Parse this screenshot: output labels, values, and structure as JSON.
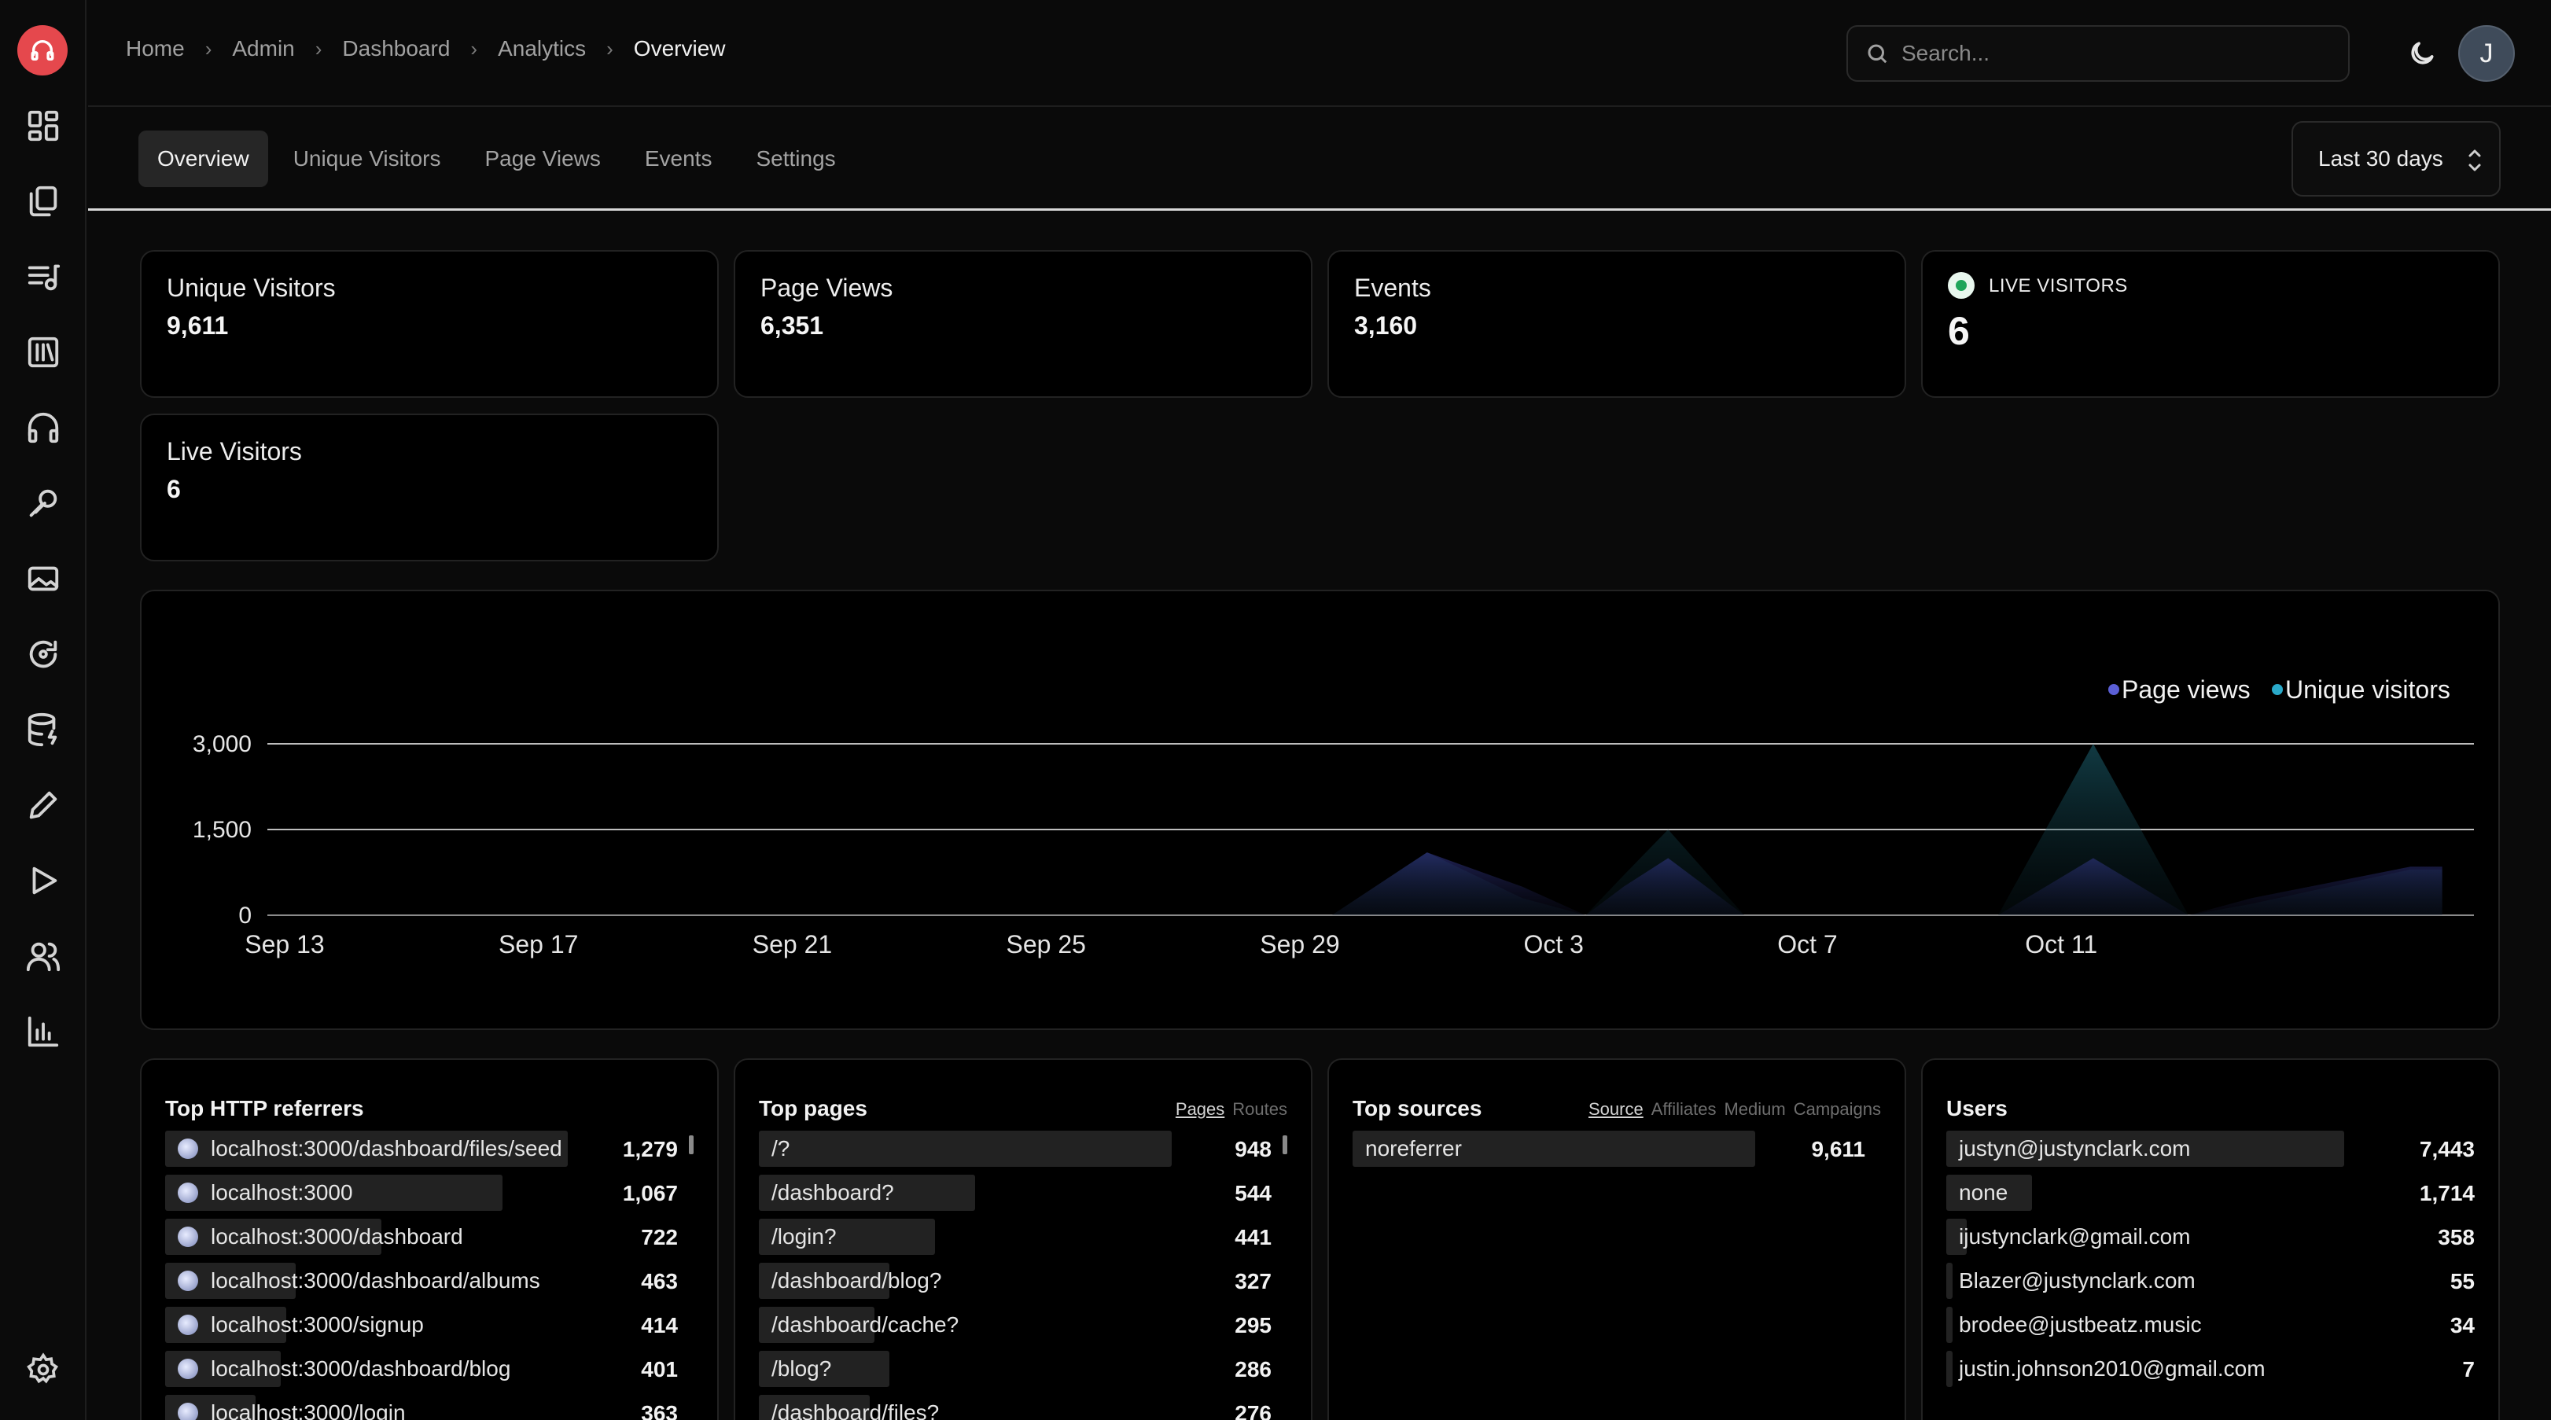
{
  "breadcrumb": [
    "Home",
    "Admin",
    "Dashboard",
    "Analytics",
    "Overview"
  ],
  "search": {
    "placeholder": "Search..."
  },
  "user": {
    "initial": "J"
  },
  "tabs": [
    "Overview",
    "Unique Visitors",
    "Page Views",
    "Events",
    "Settings"
  ],
  "range": "Last 30 days",
  "stats": [
    {
      "label": "Unique Visitors",
      "value": "9,611"
    },
    {
      "label": "Page Views",
      "value": "6,351"
    },
    {
      "label": "Events",
      "value": "3,160"
    },
    {
      "label": "Live Visitors",
      "value": "6"
    }
  ],
  "live": {
    "label": "LIVE VISITORS",
    "value": "6"
  },
  "chart_data": {
    "type": "area",
    "x": [
      "Sep 13",
      "Sep 17",
      "Sep 21",
      "Sep 25",
      "Sep 29",
      "Oct 3",
      "Oct 7",
      "Oct 11"
    ],
    "yticks": [
      "3,000",
      "1,500",
      "0"
    ],
    "ylim": [
      0,
      3000
    ],
    "legend_position": "top-right",
    "grid": true,
    "series": [
      {
        "name": "Page views",
        "color": "#5b5fd6",
        "points": [
          [
            0,
            0
          ],
          [
            17,
            0
          ],
          [
            18.5,
            1100
          ],
          [
            20,
            500
          ],
          [
            21,
            0
          ],
          [
            21.6,
            500
          ],
          [
            22.3,
            1000
          ],
          [
            23.5,
            0
          ],
          [
            27.5,
            0
          ],
          [
            29,
            1000
          ],
          [
            30.5,
            0
          ],
          [
            31.5,
            300
          ],
          [
            34,
            850
          ],
          [
            34.5,
            850
          ]
        ]
      },
      {
        "name": "Unique visitors",
        "color": "#2aa9c9",
        "points": [
          [
            0,
            0
          ],
          [
            17,
            0
          ],
          [
            18.5,
            1100
          ],
          [
            20,
            300
          ],
          [
            21,
            0
          ],
          [
            21.6,
            700
          ],
          [
            22.3,
            1500
          ],
          [
            23.5,
            0
          ],
          [
            27.5,
            0
          ],
          [
            29,
            3000
          ],
          [
            30.5,
            0
          ],
          [
            31.5,
            200
          ],
          [
            34,
            800
          ],
          [
            34.5,
            800
          ]
        ]
      }
    ]
  },
  "referrers": {
    "title": "Top HTTP referrers",
    "rows": [
      {
        "name": "localhost:3000/dashboard/files/seed",
        "value": "1,279",
        "pct": 0.8
      },
      {
        "name": "localhost:3000",
        "value": "1,067",
        "pct": 0.67
      },
      {
        "name": "localhost:3000/dashboard",
        "value": "722",
        "pct": 0.43
      },
      {
        "name": "localhost:3000/dashboard/albums",
        "value": "463",
        "pct": 0.26
      },
      {
        "name": "localhost:3000/signup",
        "value": "414",
        "pct": 0.24
      },
      {
        "name": "localhost:3000/dashboard/blog",
        "value": "401",
        "pct": 0.23
      },
      {
        "name": "localhost:3000/login",
        "value": "363",
        "pct": 0.18
      }
    ]
  },
  "pages": {
    "title": "Top pages",
    "links": [
      "Pages",
      "Routes"
    ],
    "rows": [
      {
        "name": "/?",
        "value": "948",
        "pct": 0.82
      },
      {
        "name": "/dashboard?",
        "value": "544",
        "pct": 0.43
      },
      {
        "name": "/login?",
        "value": "441",
        "pct": 0.35
      },
      {
        "name": "/dashboard/blog?",
        "value": "327",
        "pct": 0.26
      },
      {
        "name": "/dashboard/cache?",
        "value": "295",
        "pct": 0.23
      },
      {
        "name": "/blog?",
        "value": "286",
        "pct": 0.26
      },
      {
        "name": "/dashboard/files?",
        "value": "276",
        "pct": 0.22
      }
    ]
  },
  "sources": {
    "title": "Top sources",
    "links": [
      "Source",
      "Affiliates",
      "Medium",
      "Campaigns"
    ],
    "rows": [
      {
        "name": "noreferrer",
        "value": "9,611",
        "pct": 0.8
      }
    ]
  },
  "users": {
    "title": "Users",
    "rows": [
      {
        "name": "justyn@justynclark.com",
        "value": "7,443",
        "pct": 0.79
      },
      {
        "name": "none",
        "value": "1,714",
        "pct": 0.17
      },
      {
        "name": "ijustynclark@gmail.com",
        "value": "358",
        "pct": 0.04
      },
      {
        "name": "Blazer@justynclark.com",
        "value": "55",
        "pct": 0.01
      },
      {
        "name": "brodee@justbeatz.music",
        "value": "34",
        "pct": 0.01
      },
      {
        "name": "justin.johnson2010@gmail.com",
        "value": "7",
        "pct": 0.005
      }
    ]
  }
}
